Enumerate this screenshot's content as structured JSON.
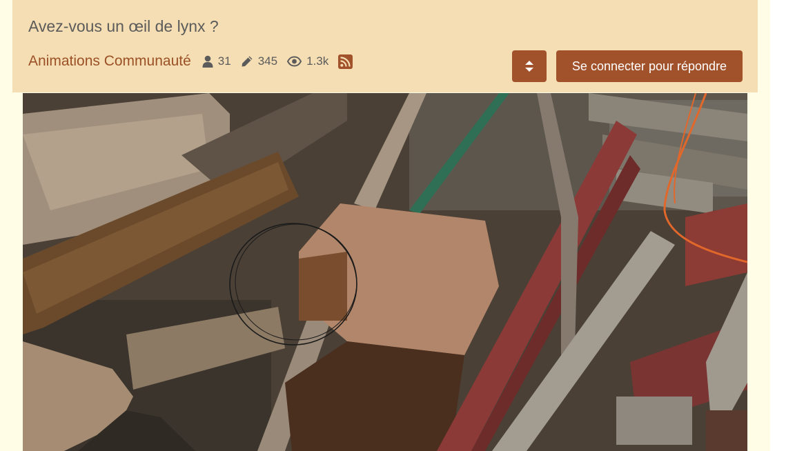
{
  "topic": {
    "title": "Avez-vous un œil de lynx ?",
    "category": "Animations Communauté"
  },
  "stats": {
    "posters": "31",
    "posts": "345",
    "views": "1.3k"
  },
  "buttons": {
    "login_label": "Se connecter pour répondre"
  },
  "icons": {
    "posters": "user-icon",
    "posts": "pencil-icon",
    "views": "eye-icon",
    "rss": "rss-icon",
    "toggle": "sort-icon"
  },
  "colors": {
    "header_bg": "#f5deb3",
    "accent": "#a2522a",
    "page_bg": "#fffde6"
  }
}
